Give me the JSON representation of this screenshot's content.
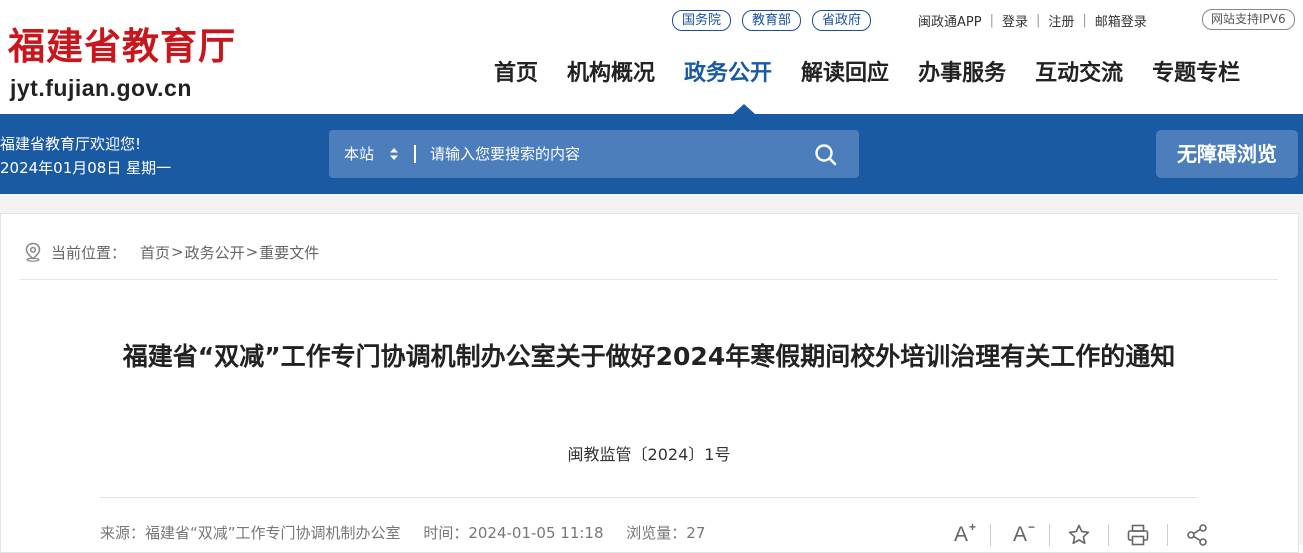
{
  "header": {
    "logo_cn": "福建省教育厅",
    "logo_domain": "jyt.fujian.gov.cn",
    "top_pills": [
      "国务院",
      "教育部",
      "省政府"
    ],
    "user_links": [
      "闽政通APP",
      "登录",
      "注册",
      "邮箱登录"
    ],
    "ipv6": "网站支持IPV6",
    "nav": [
      "首页",
      "机构概况",
      "政务公开",
      "解读回应",
      "办事服务",
      "互动交流",
      "专题专栏"
    ],
    "nav_active": "政务公开"
  },
  "band": {
    "welcome": "福建省教育厅欢迎您!",
    "date": "2024年01月08日 星期一",
    "search_scope": "本站",
    "search_placeholder": "请输入您要搜索的内容",
    "accessibility_label": "无障碍浏览"
  },
  "breadcrumb": {
    "label": "当前位置：",
    "items": [
      "首页",
      "政务公开",
      "重要文件"
    ],
    "separator": ">"
  },
  "article": {
    "title": "福建省“双减”工作专门协调机制办公室关于做好2024年寒假期间校外培训治理有关工作的通知",
    "doc_number": "闽教监管〔2024〕1号",
    "source": "来源：福建省“双减”工作专门协调机制办公室",
    "time": "时间：2024-01-05 11:18",
    "views": "浏览量：27"
  },
  "tools": {
    "font_larger": "A",
    "font_larger_mark": "+",
    "font_smaller": "A",
    "font_smaller_mark": "−"
  },
  "colors": {
    "brand_red": "#c8161d",
    "primary_blue": "#1a5aa3",
    "search_bg": "#4d7ebc"
  }
}
